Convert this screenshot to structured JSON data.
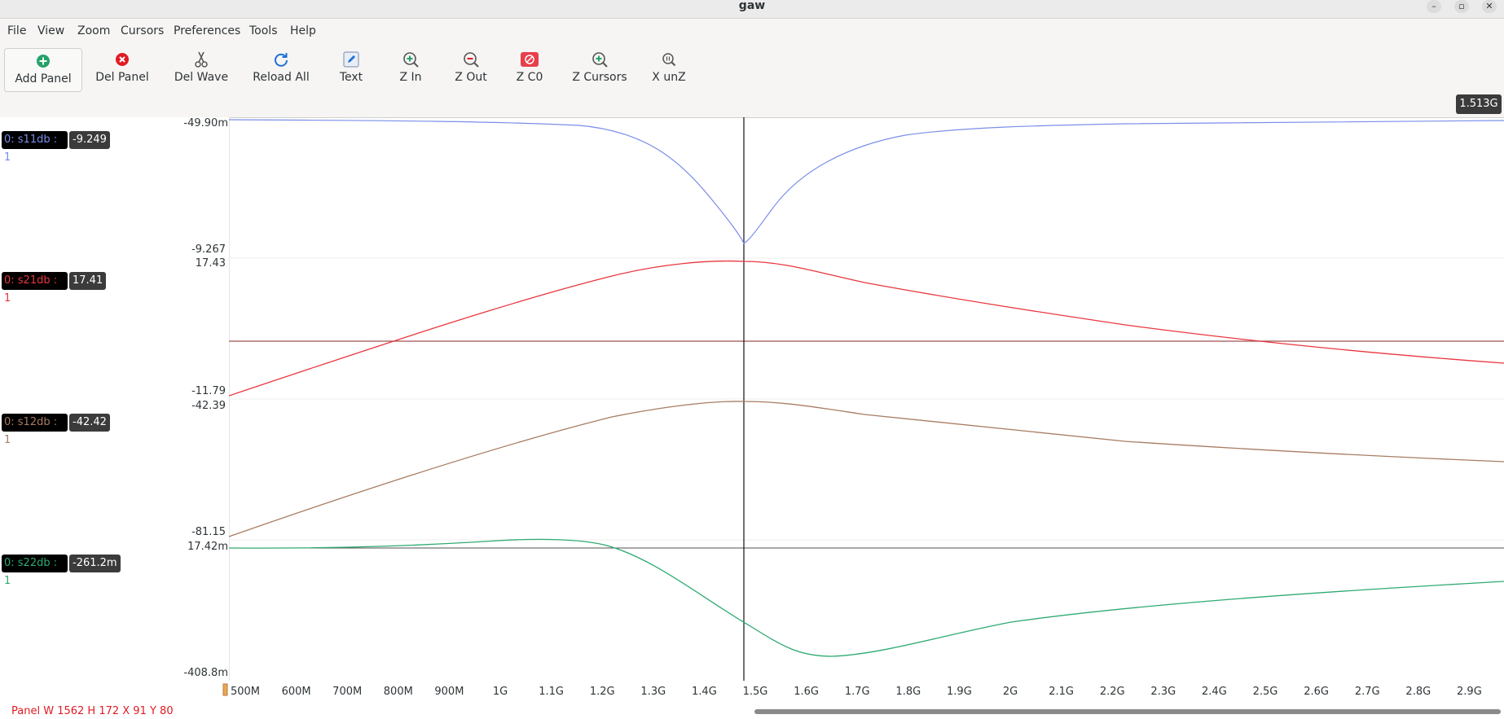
{
  "window": {
    "title": "gaw",
    "minimize": "–",
    "maximize": "▫",
    "close": "✕"
  },
  "menu": [
    "File",
    "View",
    "Zoom",
    "Cursors",
    "Preferences",
    "Tools",
    "Help"
  ],
  "toolbar": {
    "add_panel": "Add Panel",
    "del_panel": "Del Panel",
    "del_wave": "Del Wave",
    "reload_all": "Reload All",
    "text": "Text",
    "z_in": "Z In",
    "z_out": "Z Out",
    "z_c0": "Z C0",
    "z_cursors": "Z Cursors",
    "x_unz": "X unZ"
  },
  "cursor_readout": "1.513G",
  "panels": [
    {
      "label": "0: s11db : 1",
      "value": "-9.249",
      "ymax": "-49.90m",
      "ymin": "-9.267",
      "color": "#7a8ee8"
    },
    {
      "label": "0: s21db : 1",
      "value": "17.41",
      "ymax": "17.43",
      "ymin": "-11.79",
      "color": "#e8363e"
    },
    {
      "label": "0: s12db : 1",
      "value": "-42.42",
      "ymax": "-42.39",
      "ymin": "-81.15",
      "color": "#a87c62"
    },
    {
      "label": "0: s22db : 1",
      "value": "-261.2m",
      "ymax": "17.42m",
      "ymin": "-408.8m",
      "color": "#2eaa70"
    }
  ],
  "x_ticks": [
    "500M",
    "600M",
    "700M",
    "800M",
    "900M",
    "1G",
    "1.1G",
    "1.2G",
    "1.3G",
    "1.4G",
    "1.5G",
    "1.6G",
    "1.7G",
    "1.8G",
    "1.9G",
    "2G",
    "2.1G",
    "2.2G",
    "2.3G",
    "2.4G",
    "2.5G",
    "2.6G",
    "2.7G",
    "2.8G",
    "2.9G"
  ],
  "status": "Panel W 1562 H 172 X 91 Y 80",
  "icons": {
    "add_panel": "plus-circle-icon",
    "del_panel": "x-circle-icon",
    "del_wave": "scissors-icon",
    "reload_all": "reload-icon",
    "text": "pencil-icon",
    "z_in": "zoom-in-icon",
    "z_out": "zoom-out-icon",
    "z_c0": "zoom-c0-icon",
    "z_cursors": "zoom-cursors-icon",
    "x_unz": "x-unzoom-icon"
  }
}
